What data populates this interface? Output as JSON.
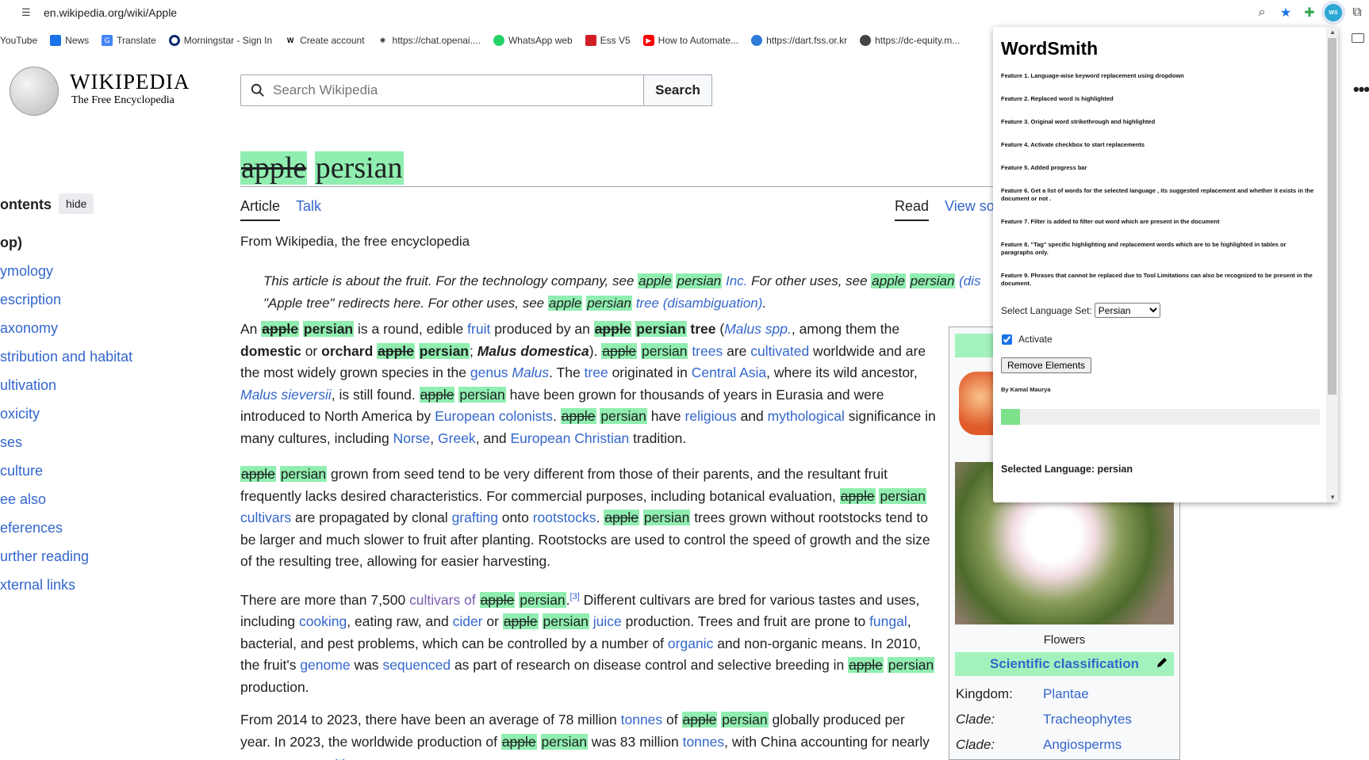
{
  "browser": {
    "url": "en.wikipedia.org/wiki/Apple",
    "extension_label": "WS",
    "bookmarks": [
      "YouTube",
      "News",
      "Translate",
      "Morningstar - Sign In",
      "Create account",
      "https://chat.openai....",
      "WhatsApp web",
      "Ess V5",
      "How to Automate...",
      "https://dart.fss.or.kr",
      "https://dc-equity.m..."
    ]
  },
  "wiki": {
    "wordmark": "WIKIPEDIA",
    "tagline": "The Free Encyclopedia",
    "search_placeholder": "Search Wikipedia",
    "search_button": "Search"
  },
  "toc": {
    "title": "ontents",
    "hide": "hide",
    "items": [
      "op)",
      "ymology",
      "escription",
      "axonomy",
      "stribution and habitat",
      "ultivation",
      "oxicity",
      "ses",
      " culture",
      "ee also",
      "eferences",
      "urther reading",
      "xternal links"
    ]
  },
  "article": {
    "title_old": "apple",
    "title_new": "persian",
    "tabs": [
      "Article",
      "Talk"
    ],
    "tabs_right": [
      "Read",
      "View so"
    ],
    "from": "From Wikipedia, the free encyclopedia",
    "old_word": "apple",
    "new_word": "persian"
  },
  "infobox": {
    "caption": "Flowers",
    "sci_class": "Scientific classification",
    "rows": [
      {
        "k": "Kingdom:",
        "v": "Plantae"
      },
      {
        "k": "Clade:",
        "v": "Tracheophytes"
      },
      {
        "k": "Clade:",
        "v": "Angiosperms"
      }
    ]
  },
  "popup": {
    "title": "WordSmith",
    "features": [
      "Feature 1. Language-wise keyword replacement using dropdown",
      "Feature 2. Replaced word is highlighted",
      "Feature 3. Original word strikethrough and highlighted",
      "Feature 4. Activate checkbox to start replacements",
      "Feature 5. Added progress bar",
      "Feature 6. Get a list of words for the selected language , its suggested replacement and whether it exists in the document or not .",
      "Feature 7. Filter is added to filter out word which are present in the document",
      "Feature 8. \"Tag\" specific highlighting and replacement words which are to be highlighted in tables or paragraphs only.",
      "Feature 9. Phrases that cannot be replaced due to Tool Limitations can also be recognized to be present in the document."
    ],
    "lang_label": "Select Language Set:",
    "lang_value": "Persian",
    "activate_label": "Activate",
    "remove_button": "Remove Elements",
    "author": "By Kamal Maurya",
    "progress": 0.06,
    "selected_language": "Selected Language: persian"
  }
}
